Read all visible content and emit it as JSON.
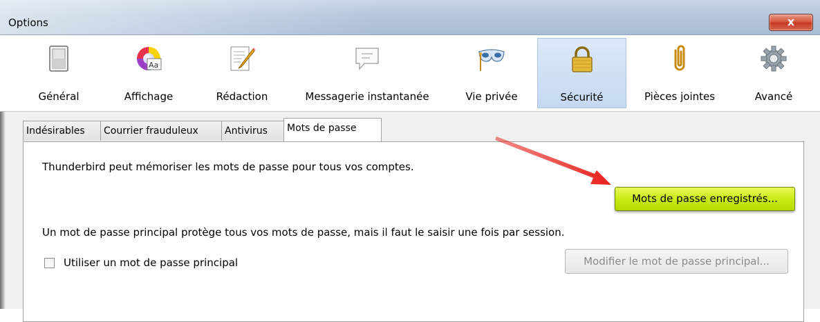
{
  "window": {
    "title": "Options",
    "close_label": "x"
  },
  "toolbar": {
    "items": [
      {
        "label": "Général",
        "icon": "general-switch-icon"
      },
      {
        "label": "Affichage",
        "icon": "display-palette-icon"
      },
      {
        "label": "Rédaction",
        "icon": "compose-pencil-icon"
      },
      {
        "label": "Messagerie instantanée",
        "icon": "chat-bubble-icon"
      },
      {
        "label": "Vie privée",
        "icon": "privacy-mask-icon"
      },
      {
        "label": "Sécurité",
        "icon": "security-padlock-icon",
        "selected": true
      },
      {
        "label": "Pièces jointes",
        "icon": "attachment-paperclip-icon"
      },
      {
        "label": "Avancé",
        "icon": "advanced-gear-icon"
      }
    ]
  },
  "tabs": {
    "items": [
      {
        "label": "Indésirables"
      },
      {
        "label": "Courrier frauduleux"
      },
      {
        "label": "Antivirus"
      },
      {
        "label": "Mots de passe",
        "active": true
      }
    ]
  },
  "passwords": {
    "info_text": "Thunderbird peut mémoriser les mots de passe pour tous vos comptes.",
    "saved_button_label": "Mots de passe enregistrés...",
    "master_info_text": "Un mot de passe principal protège tous vos mots de passe, mais il faut le saisir une fois par session.",
    "use_master_label": "Utiliser un mot de passe principal",
    "use_master_checked": false,
    "change_master_label": "Modifier le mot de passe principal..."
  },
  "colors": {
    "highlight_button": "#c9ec14",
    "arrow": "#e8201a",
    "selected_tab_bg": "#c4d9f1"
  }
}
